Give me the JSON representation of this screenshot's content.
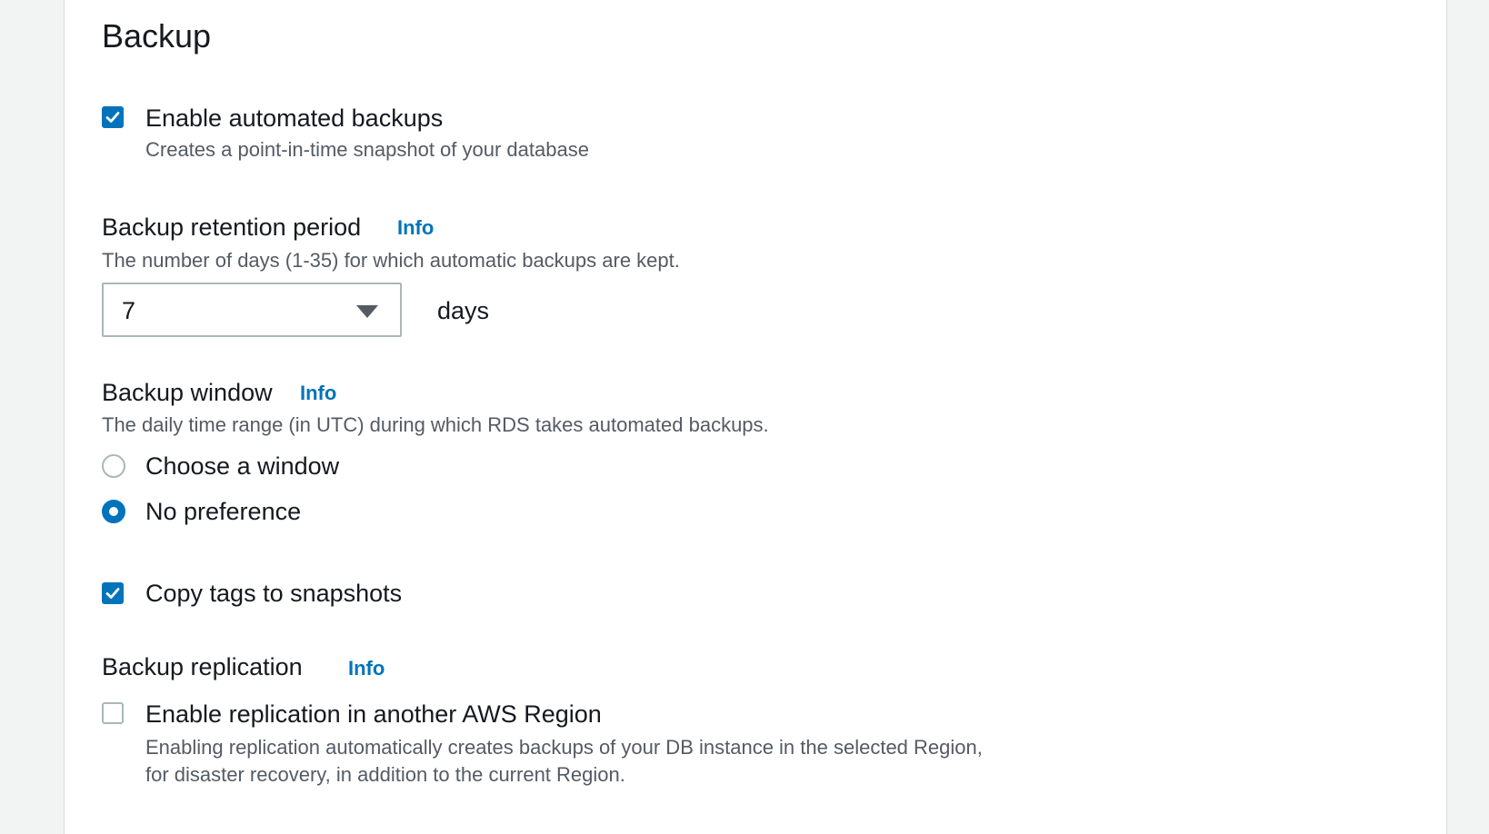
{
  "backup": {
    "title": "Backup",
    "automated_backups": {
      "label": "Enable automated backups",
      "description": "Creates a point-in-time snapshot of your database",
      "checked": true
    },
    "retention": {
      "label": "Backup retention period",
      "info": "Info",
      "description": "The number of days (1-35) for which automatic backups are kept.",
      "value": "7",
      "unit": "days"
    },
    "window": {
      "label": "Backup window",
      "info": "Info",
      "description": "The daily time range (in UTC) during which RDS takes automated backups.",
      "options": [
        {
          "label": "Choose a window",
          "selected": false
        },
        {
          "label": "No preference",
          "selected": true
        }
      ]
    },
    "copy_tags": {
      "label": "Copy tags to snapshots",
      "checked": true
    },
    "replication": {
      "label": "Backup replication",
      "info": "Info",
      "checkbox_label": "Enable replication in another AWS Region",
      "description_line1": "Enabling replication automatically creates backups of your DB instance in the selected Region,",
      "description_line2": "for disaster recovery, in addition to the current Region.",
      "checked": false
    }
  },
  "colors": {
    "accent": "#0073bb",
    "text": "#16191f",
    "muted": "#545b64",
    "border": "#aab7b8",
    "background": "#f2f3f3"
  },
  "icons": {
    "checkmark": "checkmark-icon",
    "caret": "caret-down-icon"
  }
}
